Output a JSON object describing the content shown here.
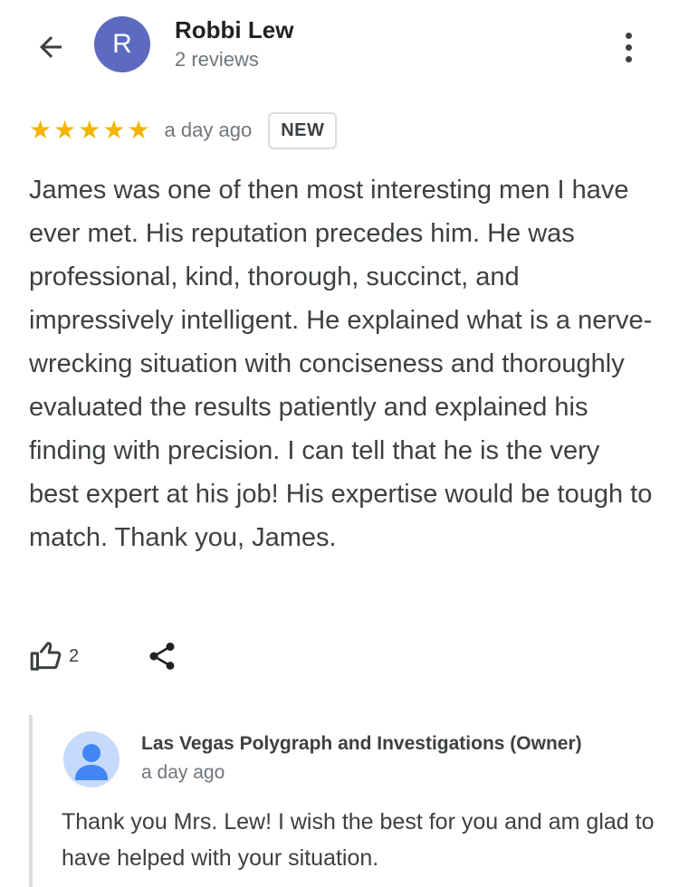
{
  "header": {
    "back_icon": "arrow-back-icon",
    "avatar_initial": "R",
    "avatar_color": "#5c6bc0",
    "name": "Robbi Lew",
    "review_count": "2 reviews",
    "more_icon": "more-vertical-icon"
  },
  "review": {
    "rating": 5,
    "max_rating": 5,
    "star_color": "#f4b400",
    "time": "a day ago",
    "badge": "NEW",
    "text": "James was one of then most interesting men I have ever met. His reputation precedes him. He was professional, kind, thorough, succinct, and impressively intelligent. He explained what is a nerve-wrecking situation with conciseness and thoroughly evaluated the results patiently and explained his finding with precision. I can tell that he is the very best expert at his job! His expertise would be tough to match. Thank you, James."
  },
  "actions": {
    "like_icon": "thumb-up-icon",
    "like_count": "2",
    "share_icon": "share-icon"
  },
  "reply": {
    "avatar_icon": "default-avatar-icon",
    "owner_name": "Las Vegas Polygraph and Investigations (Owner)",
    "time": "a day ago",
    "text": "Thank you Mrs. Lew! I wish the best for you and am glad to have helped with your situation."
  }
}
